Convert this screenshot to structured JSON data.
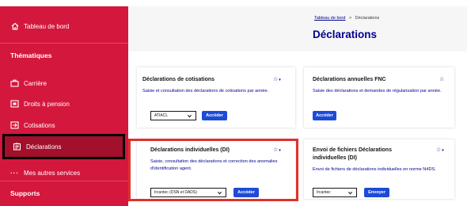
{
  "sidebar": {
    "home_label": "Tableau de bord",
    "section_thematiques": "Thématiques",
    "items": [
      {
        "label": "Carrière",
        "icon": "briefcase-icon"
      },
      {
        "label": "Droits à pension",
        "icon": "pension-icon"
      },
      {
        "label": "Cotisations",
        "icon": "cotisations-icon"
      },
      {
        "label": "Déclarations",
        "icon": "declarations-icon",
        "active": true
      }
    ],
    "other_services_label": "Mes autres services",
    "section_supports": "Supports",
    "bg_color": "#d4173c",
    "active_color": "#a2102c"
  },
  "header": {
    "breadcrumb_link": "Tableau de bord",
    "breadcrumb_separator": ">",
    "breadcrumb_current": "Déclarations",
    "title": "Déclarations"
  },
  "cards": [
    {
      "title": "Déclarations de cotisations",
      "description": "Saisie et consultation des déclarations de cotisations par année.",
      "select_value": "ATIACL",
      "button_label": "Accéder",
      "star": "☆",
      "star_caret": "▾"
    },
    {
      "title": "Déclarations annuelles FNC",
      "description": "Saisie des déclarations et demandes de régularisation par année.",
      "button_label": "Accéder",
      "star": "☆"
    },
    {
      "title": "Déclarations individuelles (DI)",
      "description": "Saisie, consultation des déclarations et correction des anomalies d'identification agent.",
      "select_value": "Ircantec (DSN et DADS)",
      "button_label": "Accéder",
      "star": "☆",
      "star_caret": "▾",
      "highlighted": true
    },
    {
      "title": "Envoi de fichiers Déclarations individuelles (DI)",
      "description": "Envoi de fichiers de déclarations individuelles en norme N4DS.",
      "select_value": "Ircantec",
      "button_label": "Envoyer",
      "star": "☆",
      "star_caret": "▾"
    }
  ],
  "colors": {
    "brand_blue": "#000091",
    "button_blue": "#1d4bd8",
    "highlight_red": "#e0312a"
  }
}
